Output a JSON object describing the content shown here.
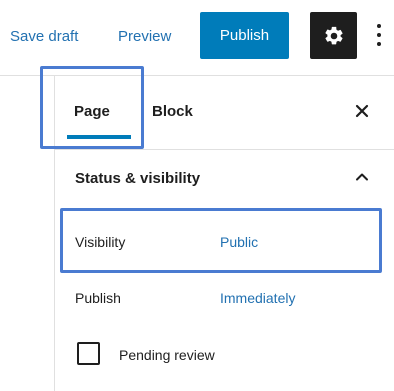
{
  "toolbar": {
    "save_draft_label": "Save draft",
    "preview_label": "Preview",
    "publish_label": "Publish",
    "settings_icon": "gear-icon",
    "more_icon": "more-vertical-icon"
  },
  "sidebar": {
    "tabs": [
      {
        "label": "Page",
        "active": true
      },
      {
        "label": "Block",
        "active": false
      }
    ],
    "close_icon": "close-icon",
    "panel": {
      "title": "Status & visibility",
      "expanded": true,
      "rows": [
        {
          "label": "Visibility",
          "value": "Public"
        },
        {
          "label": "Publish",
          "value": "Immediately"
        }
      ],
      "pending_review": {
        "label": "Pending review",
        "checked": false
      }
    }
  },
  "colors": {
    "accent": "#007cba",
    "link": "#2271b1",
    "dark": "#1e1e1e",
    "highlight": "#4a7bd1"
  }
}
